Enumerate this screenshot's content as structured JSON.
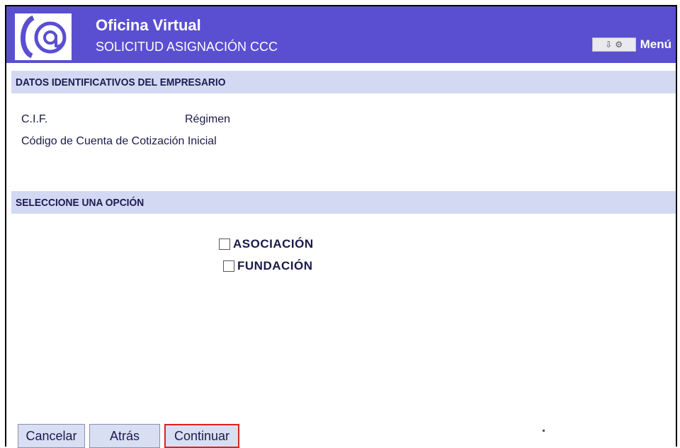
{
  "header": {
    "title": "Oficina Virtual",
    "subtitle": "SOLICITUD ASIGNACIÓN CCC",
    "menu_label": "Menú",
    "logo_icon": "at-sign-logo-icon"
  },
  "section1": {
    "title": "DATOS IDENTIFICATIVOS DEL EMPRESARIO",
    "cif_label": "C.I.F.",
    "regimen_label": "Régimen",
    "ccc_label": "Código de Cuenta de Cotización Inicial"
  },
  "section2": {
    "title": "SELECCIONE UNA OPCIÓN",
    "options": [
      "ASOCIACIÓN",
      "FUNDACIÓN"
    ]
  },
  "buttons": {
    "cancel": "Cancelar",
    "back": "Atrás",
    "continue": "Continuar"
  },
  "colors": {
    "header_bg": "#5a4fd0",
    "section_bg": "#d3d9f3",
    "focus_border": "#d22222"
  }
}
